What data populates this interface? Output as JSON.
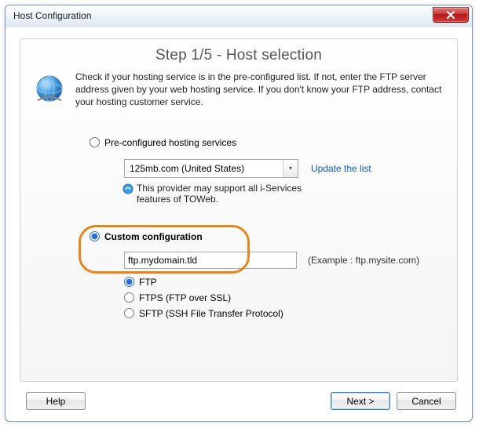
{
  "window": {
    "title": "Host Configuration"
  },
  "panel": {
    "step_title": "Step 1/5 - Host selection",
    "intro": "Check if your hosting service is in the pre-configured list. If not, enter the FTP server address given by your web hosting service. If you don't know your FTP address, contact your hosting customer service."
  },
  "preconfig": {
    "label": "Pre-configured hosting services",
    "selected": "125mb.com (United States)",
    "update_link": "Update the list",
    "note": "This provider may support all i-Services features of TOWeb."
  },
  "custom": {
    "label": "Custom configuration",
    "host_value": "ftp.mydomain.tld",
    "example": "(Example : ftp.mysite.com)",
    "protocols": {
      "ftp": "FTP",
      "ftps": "FTPS (FTP over SSL)",
      "sftp": "SFTP (SSH File Transfer Protocol)"
    }
  },
  "buttons": {
    "help": "Help",
    "next": "Next >",
    "cancel": "Cancel"
  }
}
